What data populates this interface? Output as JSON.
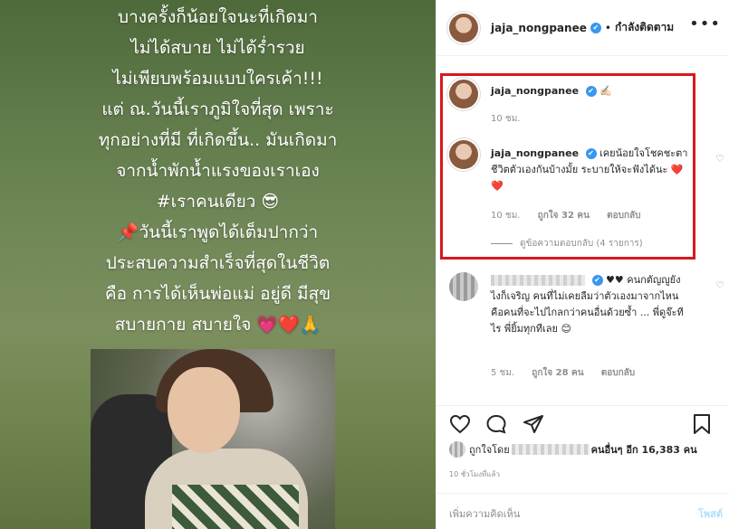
{
  "media": {
    "caption_lines": [
      "บางครั้งก็น้อยใจนะที่เกิดมา",
      "ไม่ได้สบาย ไม่ได้ร่ำรวย",
      "ไม่เพียบพร้อมแบบใครเค้า!!!",
      "แต่ ณ.วันนี้เราภูมิใจที่สุด เพราะ",
      "ทุกอย่างที่มี ที่เกิดขึ้น.. มันเกิดมา",
      "จากน้ำพักน้ำแรงของเราเอง",
      "#เราคนเดียว 😎",
      "📌วันนี้เราพูดได้เต็มปากว่า",
      "ประสบความสำเร็จที่สุดในชีวิต",
      "คือ การได้เห็นพ่อแม่ อยู่ดี มีสุข",
      "สบายกาย สบายใจ 💗❤️🙏"
    ]
  },
  "header": {
    "username": "jaja_nongpanee",
    "verified_icon": "✔",
    "dot": "•",
    "follow_status": "กำลังติดตาม",
    "more": "•••"
  },
  "comments": [
    {
      "username": "jaja_nongpanee",
      "text": "✍🏻",
      "time": "10 ชม."
    },
    {
      "username": "jaja_nongpanee",
      "text": "เคยน้อยใจโชคชะตาชีวิตตัวเองกันบ้างมั้ย ระบายให้จะฟังได้นะ ❤️❤️",
      "time": "10 ชม.",
      "likes": "ถูกใจ 32 คน",
      "reply": "ตอบกลับ",
      "view_replies": "ดูข้อความตอบกลับ (4 รายการ)"
    },
    {
      "text": "♥♥ คนกตัญญูยังไงก็เจริญ คนที่ไม่เคยลืมว่าตัวเองมาจากไหน คือคนที่จะไปไกลกว่าคนอื่นด้วยซ้ำ ... พี่ดูจ๊ะทีไร พี่ยิ้มทุกทีเลย 😊",
      "time": "5 ชม.",
      "likes": "ถูกใจ 28 คน",
      "reply": "ตอบกลับ"
    }
  ],
  "actions": {
    "like_icon": "heart-outline",
    "comment_icon": "speech-bubble",
    "share_icon": "paper-plane",
    "save_icon": "bookmark"
  },
  "likes": {
    "prefix": "ถูกใจโดย",
    "suffix": "คนอื่นๆ อีก 16,383 คน"
  },
  "time_ago": "10 ชั่วโมงที่แล้ว",
  "add_comment": {
    "placeholder": "เพิ่มความคิดเห็น",
    "post": "โพสต์"
  }
}
